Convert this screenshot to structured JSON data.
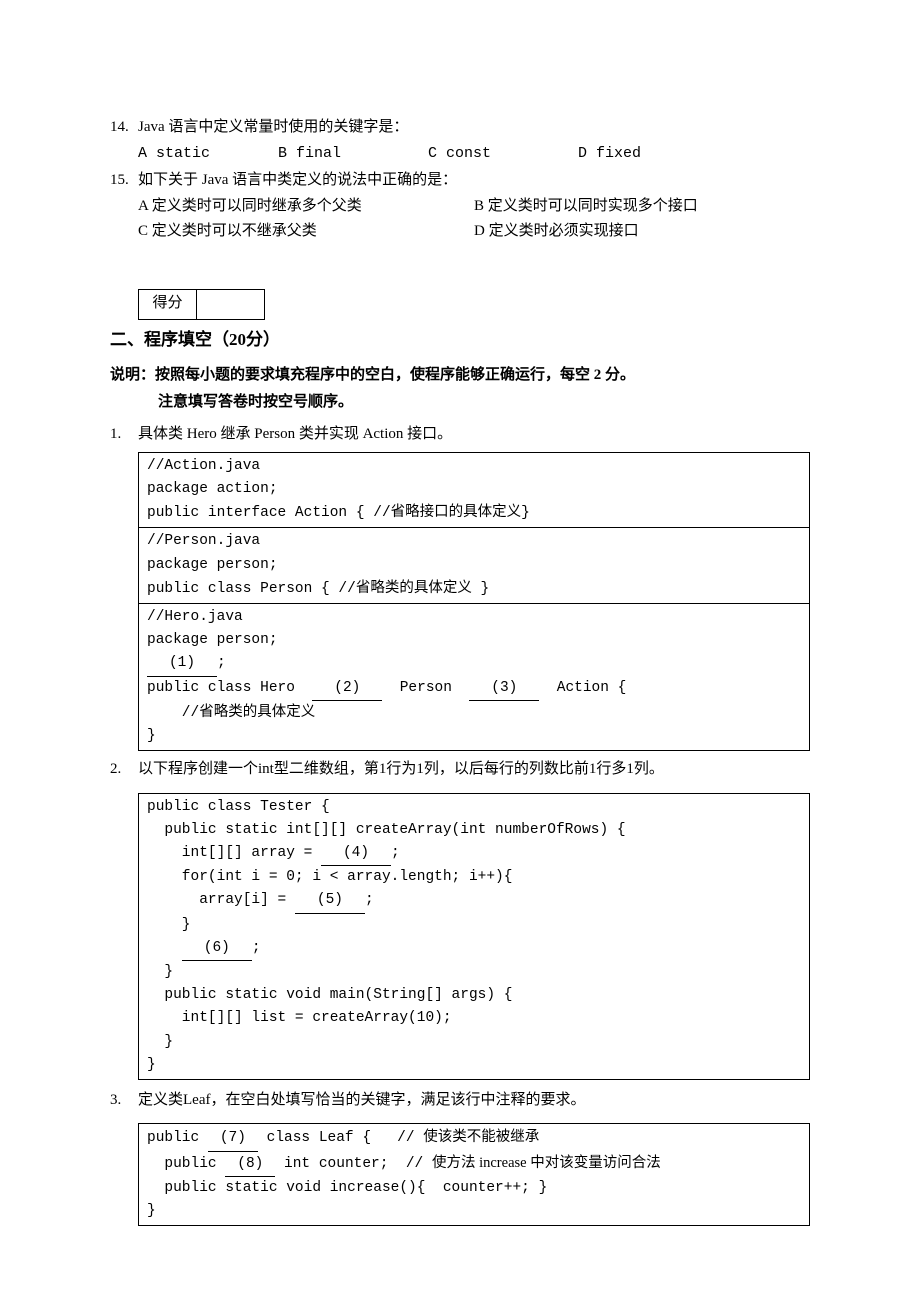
{
  "questions": [
    {
      "num": "14.",
      "stem": "Java 语言中定义常量时使用的关键字是：",
      "options": [
        "A static",
        "B final",
        "C const",
        "D fixed"
      ]
    },
    {
      "num": "15.",
      "stem": "如下关于 Java 语言中类定义的说法中正确的是：",
      "options": [
        "A 定义类时可以同时继承多个父类",
        "B 定义类时可以同时实现多个接口",
        "C 定义类时可以不继承父类",
        "D 定义类时必须实现接口"
      ]
    }
  ],
  "score_label": "得分",
  "section2_title": "二、程序填空（20分）",
  "section2_instr_l1": "说明：按照每小题的要求填充程序中的空白，使程序能够正确运行，每空 2 分。",
  "section2_instr_l2": "注意填写答卷时按空号顺序。",
  "s2q1": {
    "num": "1.",
    "stem": "具体类 Hero 继承 Person 类并实现 Action 接口。",
    "code1_l1": "//Action.java",
    "code1_l2": "package action;",
    "code1_l3_a": "public interface Action { //",
    "code1_l3_b": "省略接口的具体定义",
    "code1_l3_c": "}",
    "code2_l1": "//Person.java",
    "code2_l2": "package person;",
    "code2_l3_a": "public class Person { //",
    "code2_l3_b": "省略类的具体定义",
    "code2_l3_c": " }",
    "code3_l1": "//Hero.java",
    "code3_l2": "package person;",
    "blank1": "(1)",
    "code3_l3_b": ";",
    "code3_l4_a": "public class Hero  ",
    "blank2": "(2)",
    "code3_l4_b": "  Person  ",
    "blank3": "(3)",
    "code3_l4_c": "  Action {",
    "code3_l5_a": "    //",
    "code3_l5_b": "省略类的具体定义",
    "code3_l6": "}"
  },
  "s2q2": {
    "num": "2.",
    "stem": "以下程序创建一个int型二维数组，第1行为1列，以后每行的列数比前1行多1列。",
    "l1": "public class Tester {",
    "l2": "  public static int[][] createArray(int numberOfRows) {",
    "l3a": "    int[][] array = ",
    "blank4": "(4)",
    "l3b": ";",
    "l4": "    for(int i = 0; i < array.length; i++){",
    "l5a": "      array[i] = ",
    "blank5": "(5)",
    "l5b": ";",
    "l6": "    }",
    "l7a": "    ",
    "blank6": "(6)",
    "l7b": ";",
    "l8": "  }",
    "l9": "  public static void main(String[] args) {",
    "l10": "    int[][] list = createArray(10);",
    "l11": "  }",
    "l12": "}"
  },
  "s2q3": {
    "num": "3.",
    "stem": "定义类Leaf，在空白处填写恰当的关键字，满足该行中注释的要求。",
    "l1a": "public ",
    "blank7": "(7)",
    "l1b": " class Leaf {   // ",
    "l1c": "使该类不能被继承",
    "l2a": "  public ",
    "blank8": "(8)",
    "l2b": " int counter;  // ",
    "l2c": "使方法 increase 中对该变量访问合法",
    "l3": "  public static void increase(){  counter++; }",
    "l4": "}"
  }
}
